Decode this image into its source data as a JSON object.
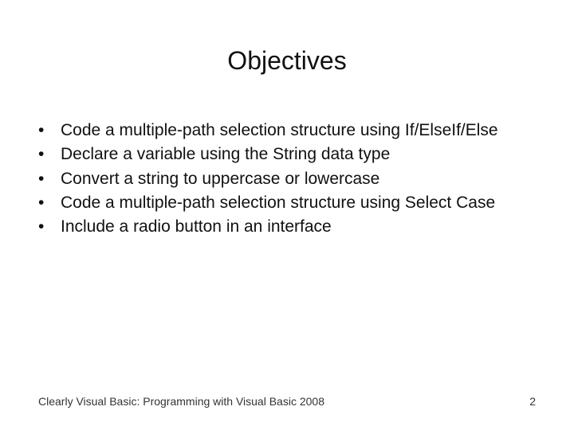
{
  "title": "Objectives",
  "bullets": [
    "Code a multiple-path selection structure using If/ElseIf/Else",
    "Declare a variable using the String data type",
    "Convert a string to uppercase or lowercase",
    "Code a multiple-path selection structure using Select Case",
    "Include a radio button in an interface"
  ],
  "footer": {
    "text": "Clearly Visual Basic: Programming with Visual Basic 2008",
    "page": "2"
  }
}
